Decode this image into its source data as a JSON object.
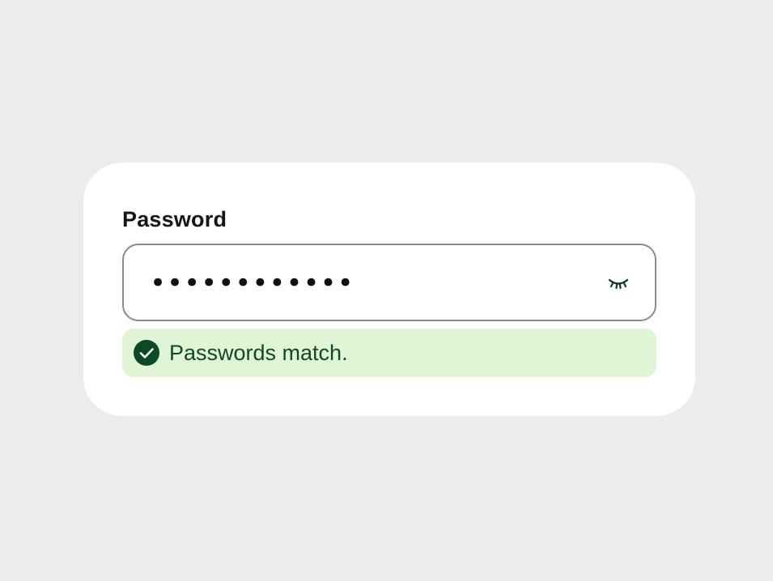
{
  "password_field": {
    "label": "Password",
    "masked_value": "••••••••••••",
    "toggle_icon": "eye-closed-icon"
  },
  "validation": {
    "icon": "check-circle-icon",
    "message": "Passwords match."
  },
  "colors": {
    "background": "#ecedea",
    "card": "#ffffff",
    "input_border": "#8a8a8a",
    "success_bg": "#e0f4d6",
    "success_fg": "#0f4a22",
    "check_icon": "#0b4a25"
  }
}
